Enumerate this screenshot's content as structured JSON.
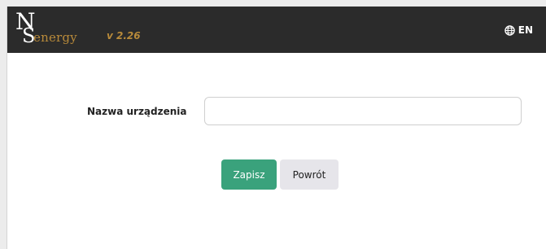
{
  "header": {
    "logo_monogram": "NS",
    "brand": "energy",
    "version": "v 2.26",
    "language": {
      "icon": "globe-icon",
      "label": "EN"
    }
  },
  "form": {
    "device_name_label": "Nazwa urządzenia",
    "device_name_value": "",
    "device_name_placeholder": ""
  },
  "actions": {
    "save_label": "Zapisz",
    "back_label": "Powrót"
  },
  "colors": {
    "header_bg": "#2b2b2b",
    "brand_gold": "#b88a3a",
    "save_button": "#3aa27c",
    "back_button": "#e6e5ea"
  }
}
